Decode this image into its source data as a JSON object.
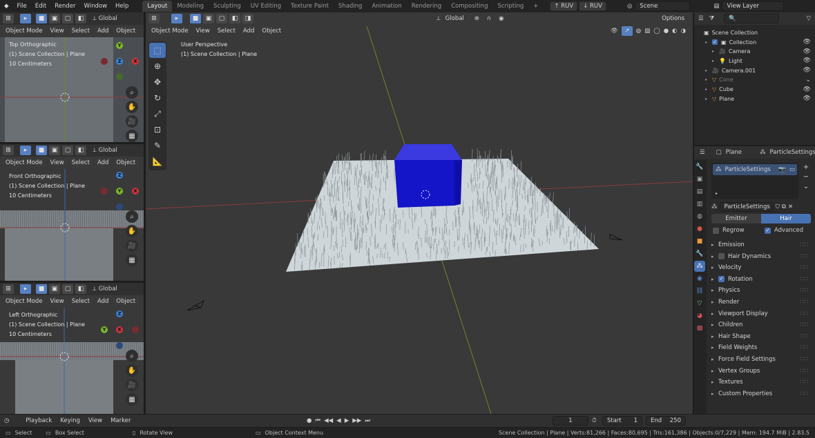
{
  "topbar": {
    "menus": [
      "File",
      "Edit",
      "Render",
      "Window",
      "Help"
    ],
    "workspaces": [
      {
        "label": "Layout",
        "active": true
      },
      {
        "label": "Modeling"
      },
      {
        "label": "Sculpting"
      },
      {
        "label": "UV Editing"
      },
      {
        "label": "Texture Paint"
      },
      {
        "label": "Shading"
      },
      {
        "label": "Animation"
      },
      {
        "label": "Rendering"
      },
      {
        "label": "Compositing"
      },
      {
        "label": "Scripting"
      }
    ],
    "add_tab": "+",
    "ruv_left": "RUV",
    "ruv_right": "RUV",
    "scene": "Scene",
    "view_layer": "View Layer"
  },
  "small_header": {
    "orientation": "Global",
    "mode": "Object Mode",
    "menus": [
      "View",
      "Select",
      "Add",
      "Object"
    ]
  },
  "viewports_small": [
    {
      "name": "Top Orthographic",
      "collection": "(1) Scene Collection | Plane",
      "units": "10 Centimeters",
      "axes": [
        "Y",
        "Z",
        "X"
      ]
    },
    {
      "name": "Front Orthographic",
      "collection": "(1) Scene Collection | Plane",
      "units": "10 Centimeters",
      "axes": [
        "Z",
        "Y",
        "X"
      ]
    },
    {
      "name": "Left Orthographic",
      "collection": "(1) Scene Collection | Plane",
      "units": "10 Centimeters",
      "axes": [
        "Z",
        "Y",
        "X"
      ]
    }
  ],
  "main_viewport": {
    "mode": "Object Mode",
    "menus": [
      "View",
      "Select",
      "Add",
      "Object"
    ],
    "orientation": "Global",
    "options": "Options",
    "name": "User Perspective",
    "collection": "(1) Scene Collection | Plane"
  },
  "outliner": {
    "root": "Scene Collection",
    "items": [
      {
        "label": "Collection",
        "indent": 1,
        "icon": "collection-icon"
      },
      {
        "label": "Camera",
        "indent": 2,
        "icon": "camera-icon"
      },
      {
        "label": "Light",
        "indent": 2,
        "icon": "light-icon"
      },
      {
        "label": "Camera.001",
        "indent": 1,
        "icon": "camera-icon"
      },
      {
        "label": "Cone",
        "indent": 1,
        "icon": "cone-icon",
        "dim": true
      },
      {
        "label": "Cube",
        "indent": 1,
        "icon": "mesh-icon"
      },
      {
        "label": "Plane",
        "indent": 1,
        "icon": "mesh-icon"
      }
    ]
  },
  "properties": {
    "object": "Plane",
    "particle_label": "ParticleSettings",
    "list_item": "ParticleSettings",
    "settings_name": "ParticleSettings",
    "type_emitter": "Emitter",
    "type_hair": "Hair",
    "regrow": "Regrow",
    "advanced": "Advanced",
    "panels": [
      {
        "label": "Emission"
      },
      {
        "label": "Hair Dynamics",
        "checkbox": false
      },
      {
        "label": "Velocity"
      },
      {
        "label": "Rotation",
        "checkbox": true
      },
      {
        "label": "Physics"
      },
      {
        "label": "Render"
      },
      {
        "label": "Viewport Display"
      },
      {
        "label": "Children"
      },
      {
        "label": "Hair Shape"
      },
      {
        "label": "Field Weights"
      },
      {
        "label": "Force Field Settings"
      },
      {
        "label": "Vertex Groups"
      },
      {
        "label": "Textures"
      },
      {
        "label": "Custom Properties"
      }
    ]
  },
  "timeline": {
    "menus": [
      "Playback",
      "Keying",
      "View",
      "Marker"
    ],
    "frame": "1",
    "start_label": "Start",
    "start": "1",
    "end_label": "End",
    "end": "250"
  },
  "statusbar": {
    "select": "Select",
    "box_select": "Box Select",
    "rotate_view": "Rotate View",
    "context_menu": "Object Context Menu",
    "stats": "Scene Collection | Plane | Verts:81,266 | Faces:80,695 | Tris:161,386 | Objects:0/7,229 | Mem: 194.7 MiB | 2.83.5"
  },
  "colors": {
    "accent": "#4772b3",
    "cube": "#1414c8",
    "x_axis": "#d0333e",
    "y_axis": "#7ab827",
    "z_axis": "#3a82d6",
    "viewport_bg": "#393939"
  }
}
